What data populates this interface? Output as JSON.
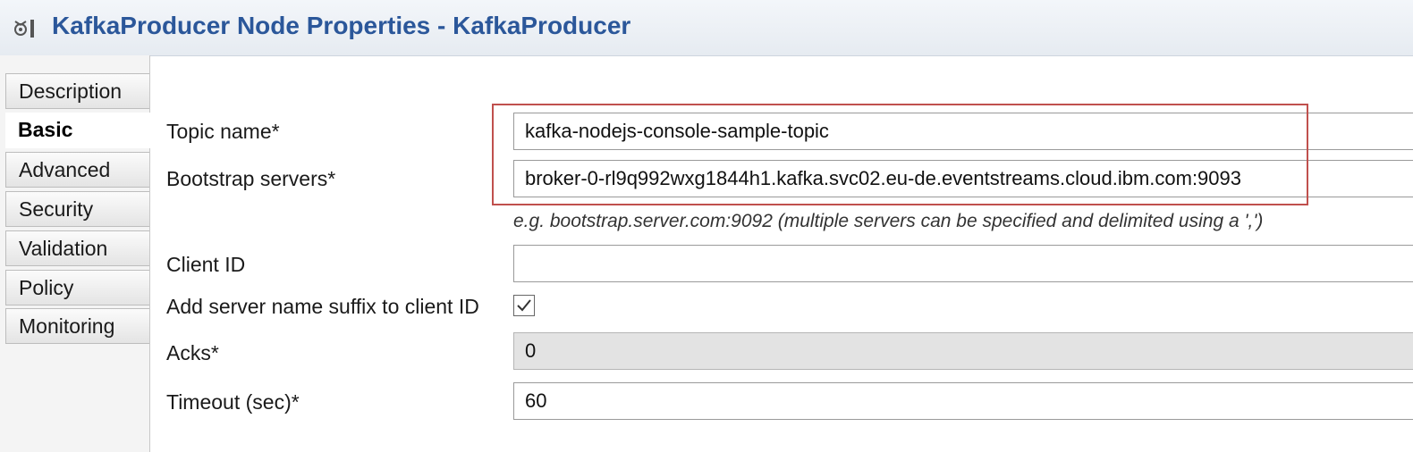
{
  "window": {
    "title": "KafkaProducer Node Properties - KafkaProducer",
    "icon": "node-properties-icon"
  },
  "tabs": [
    {
      "label": "Description",
      "active": false
    },
    {
      "label": "Basic",
      "active": true
    },
    {
      "label": "Advanced",
      "active": false
    },
    {
      "label": "Security",
      "active": false
    },
    {
      "label": "Validation",
      "active": false
    },
    {
      "label": "Policy",
      "active": false
    },
    {
      "label": "Monitoring",
      "active": false
    }
  ],
  "form": {
    "topic_name": {
      "label": "Topic name*",
      "value": "kafka-nodejs-console-sample-topic"
    },
    "bootstrap_servers": {
      "label": "Bootstrap servers*",
      "value": "broker-0-rl9q992wxg1844h1.kafka.svc02.eu-de.eventstreams.cloud.ibm.com:9093",
      "hint": "e.g. bootstrap.server.com:9092 (multiple servers can be specified and delimited using a ',')"
    },
    "client_id": {
      "label": "Client ID",
      "value": ""
    },
    "server_suffix": {
      "label": "Add server name suffix to client ID",
      "checked": true
    },
    "acks": {
      "label": "Acks*",
      "value": "0"
    },
    "timeout": {
      "label": "Timeout (sec)*",
      "value": "60"
    }
  },
  "colors": {
    "title": "#2b579a",
    "highlight_border": "#c0504d"
  }
}
